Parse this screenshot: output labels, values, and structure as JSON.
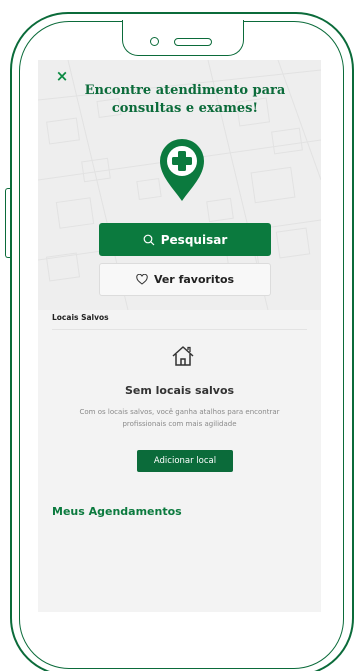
{
  "header": {
    "close_label": "×",
    "title_line1": "Encontre atendimento para",
    "title_line2": "consultas e exames!"
  },
  "actions": {
    "search_label": "Pesquisar",
    "favorites_label": "Ver favoritos"
  },
  "saved_places": {
    "section_title": "Locais Salvos",
    "empty_title": "Sem locais salvos",
    "empty_description": "Com os locais salvos, você ganha atalhos para encontrar profissionais com mais agilidade",
    "add_button_label": "Adicionar local"
  },
  "appointments": {
    "section_title": "Meus Agendamentos"
  },
  "icons": {
    "close": "close-icon",
    "pin": "location-pin-plus-icon",
    "search": "search-icon",
    "heart": "heart-icon",
    "home": "home-icon"
  },
  "colors": {
    "brand_green": "#0b7a3e",
    "dark_green": "#0b6b3a",
    "background": "#f3f3f3"
  }
}
